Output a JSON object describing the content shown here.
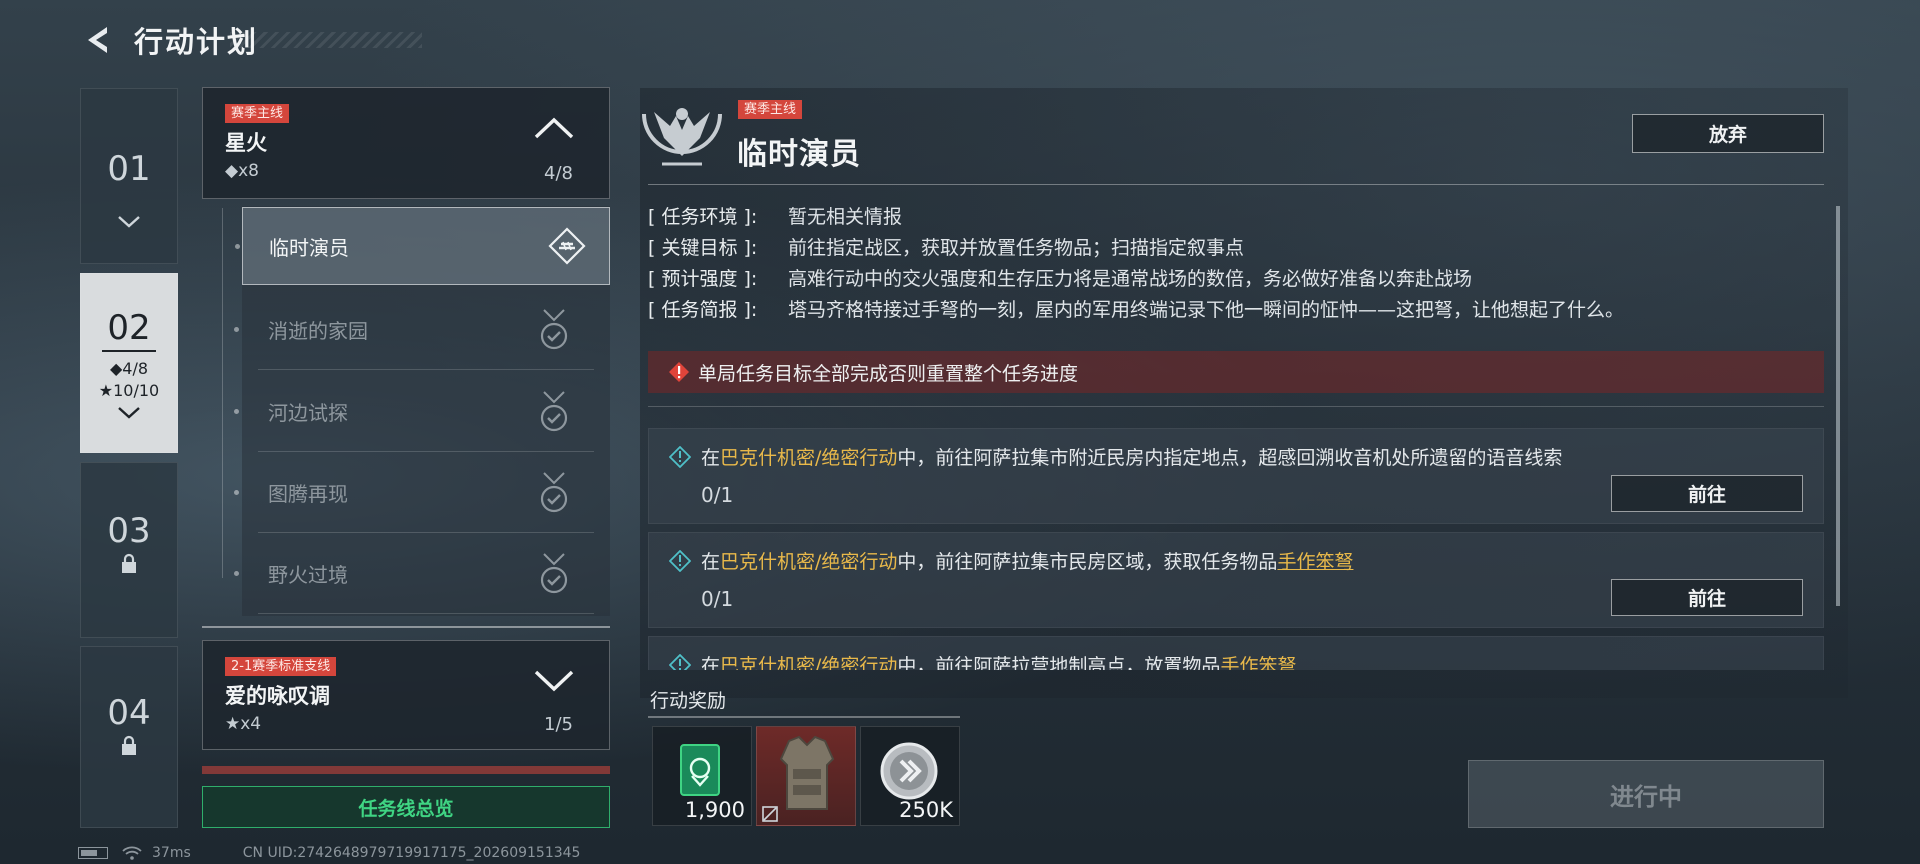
{
  "header": {
    "title": "行动计划"
  },
  "chapters": [
    {
      "num": "01"
    },
    {
      "num": "02",
      "diamonds": "◆4/8",
      "stars": "★10/10"
    },
    {
      "num": "03"
    },
    {
      "num": "04"
    }
  ],
  "groups": [
    {
      "tag": "赛季主线",
      "name": "星火",
      "meta": "◆x8",
      "count": "4/8"
    },
    {
      "tag": "2-1赛季标准支线",
      "name": "爱的咏叹调",
      "meta": "★x4",
      "count": "1/5"
    }
  ],
  "sub_missions": [
    {
      "label": "临时演员"
    },
    {
      "label": "消逝的家园"
    },
    {
      "label": "河边试探"
    },
    {
      "label": "图腾再现"
    },
    {
      "label": "野火过境"
    }
  ],
  "overview_button": "任务线总览",
  "detail": {
    "tag": "赛季主线",
    "title": "临时演员",
    "abandon": "放弃",
    "info": [
      {
        "k": "[ 任务环境 ]:",
        "v": "暂无相关情报"
      },
      {
        "k": "[ 关键目标 ]:",
        "v": "前往指定战区，获取并放置任务物品；扫描指定叙事点"
      },
      {
        "k": "[ 预计强度 ]:",
        "v": "高难行动中的交火强度和生存压力将是通常战场的数倍，务必做好准备以奔赴战场"
      },
      {
        "k": "[ 任务简报 ]:",
        "v": "塔马齐格特接过手弩的一刻，屋内的军用终端记录下他一瞬间的怔忡——这把弩，让他想起了什么。"
      }
    ],
    "warning": "单局任务目标全部完成否则重置整个任务进度",
    "objectives": [
      {
        "pre": "在",
        "map": "巴克什机密/绝密行动",
        "mid": "中，前往阿萨拉集市附近民房内指定地点，超感回溯收音机处所遗留的语音线索",
        "item": "",
        "progress": "0/1",
        "button": "前往"
      },
      {
        "pre": "在",
        "map": "巴克什机密/绝密行动",
        "mid": "中，前往阿萨拉集市民房区域，获取任务物品",
        "item": "手作笨弩",
        "progress": "0/1",
        "button": "前往"
      },
      {
        "pre": "在",
        "map": "巴克什机密/绝密行动",
        "mid": "中，前往阿萨拉营地制高点，放置物品",
        "item": "手作笨弩",
        "progress": "",
        "button": ""
      }
    ],
    "rewards_title": "行动奖励",
    "rewards": [
      {
        "qty": "1,900",
        "icon": "exp-card-icon"
      },
      {
        "qty": "",
        "icon": "armor-vest-icon"
      },
      {
        "qty": "250K",
        "icon": "coin-icon"
      }
    ],
    "status_button": "进行中"
  },
  "status": {
    "ping": "37ms",
    "uid": "CN UID:2742648979719917175_202609151345"
  },
  "colors": {
    "accent_green": "#3fd483",
    "tag_red": "#d4463c",
    "highlight_gold": "#e9b94a"
  }
}
